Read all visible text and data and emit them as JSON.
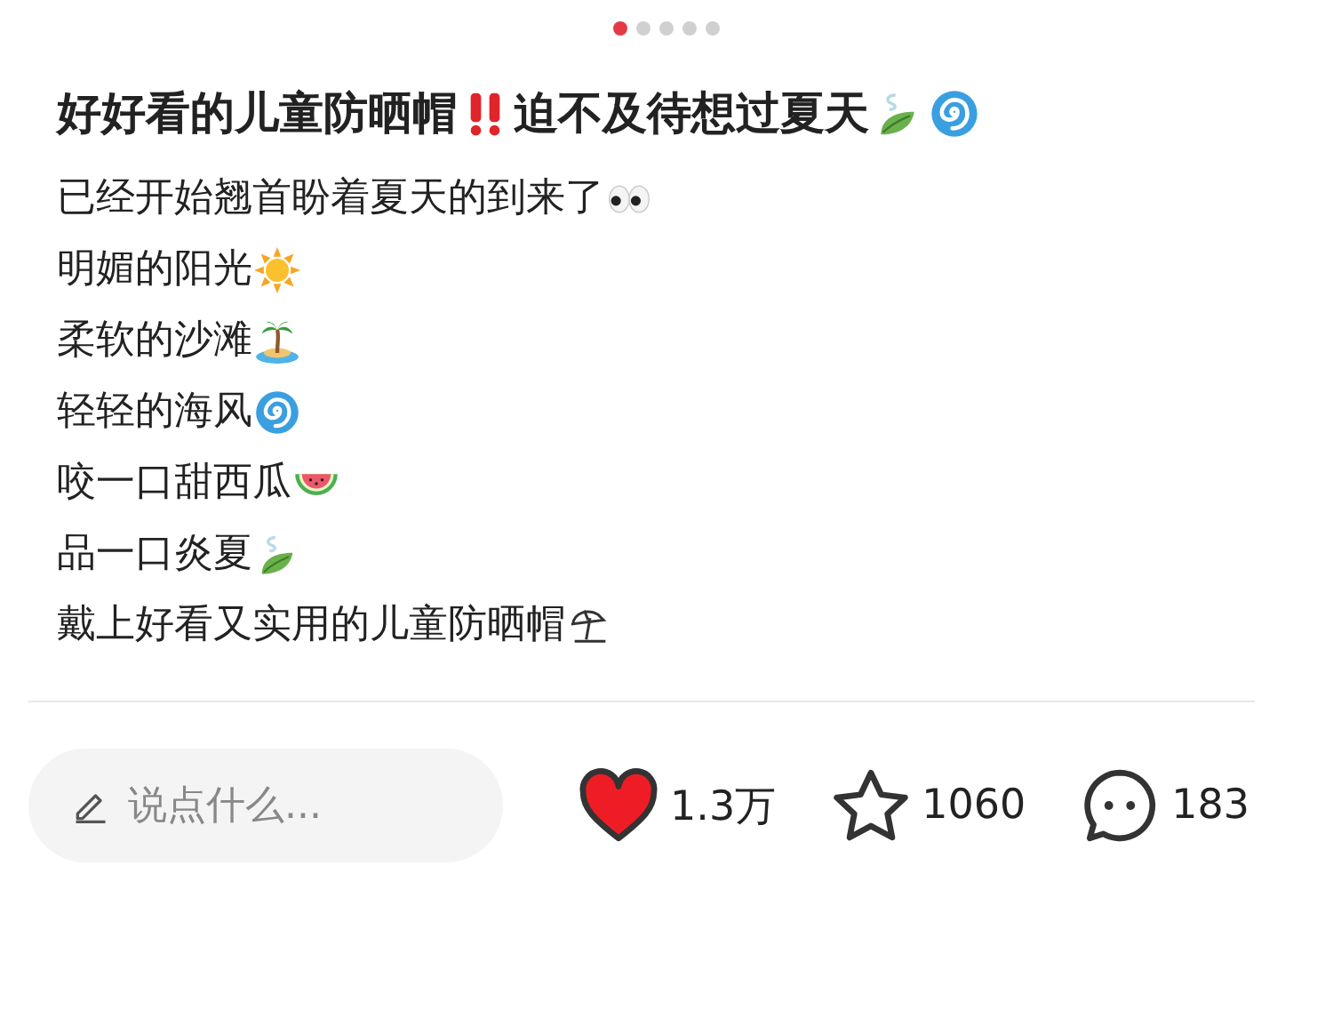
{
  "carousel_dots": [
    {
      "selected": true
    },
    {
      "selected": false
    },
    {
      "selected": false
    },
    {
      "selected": false
    },
    {
      "selected": false
    }
  ],
  "title": [
    {
      "kind": "text",
      "text": "好好看的儿童防晒帽"
    },
    {
      "kind": "exclamation"
    },
    {
      "kind": "text",
      "text": "迫不及待想过夏天"
    },
    {
      "kind": "leaf"
    },
    {
      "kind": "cyclone"
    }
  ],
  "body_lines": [
    {
      "parts": [
        {
          "kind": "text",
          "text": "已经开始翘首盼着夏天的到来了"
        },
        {
          "kind": "eyes"
        }
      ]
    },
    {
      "parts": [
        {
          "kind": "text",
          "text": "明媚的阳光"
        },
        {
          "kind": "sun"
        }
      ]
    },
    {
      "parts": [
        {
          "kind": "text",
          "text": "柔软的沙滩"
        },
        {
          "kind": "island"
        }
      ]
    },
    {
      "parts": [
        {
          "kind": "text",
          "text": "轻轻的海风"
        },
        {
          "kind": "cyclone"
        }
      ]
    },
    {
      "parts": [
        {
          "kind": "text",
          "text": "咬一口甜西瓜"
        },
        {
          "kind": "watermelon"
        }
      ]
    },
    {
      "parts": [
        {
          "kind": "text",
          "text": "品一口炎夏"
        },
        {
          "kind": "leaf"
        }
      ]
    },
    {
      "parts": [
        {
          "kind": "text",
          "text": "戴上好看又实用的儿童防晒帽"
        },
        {
          "kind": "umbrella"
        }
      ]
    }
  ],
  "comment_field": {
    "placeholder": "说点什么..."
  },
  "actions": [
    {
      "kind": "like",
      "count": "1.3万",
      "selected": true
    },
    {
      "kind": "collect",
      "count": "1060",
      "selected": false
    },
    {
      "kind": "comment",
      "count": "183"
    }
  ]
}
